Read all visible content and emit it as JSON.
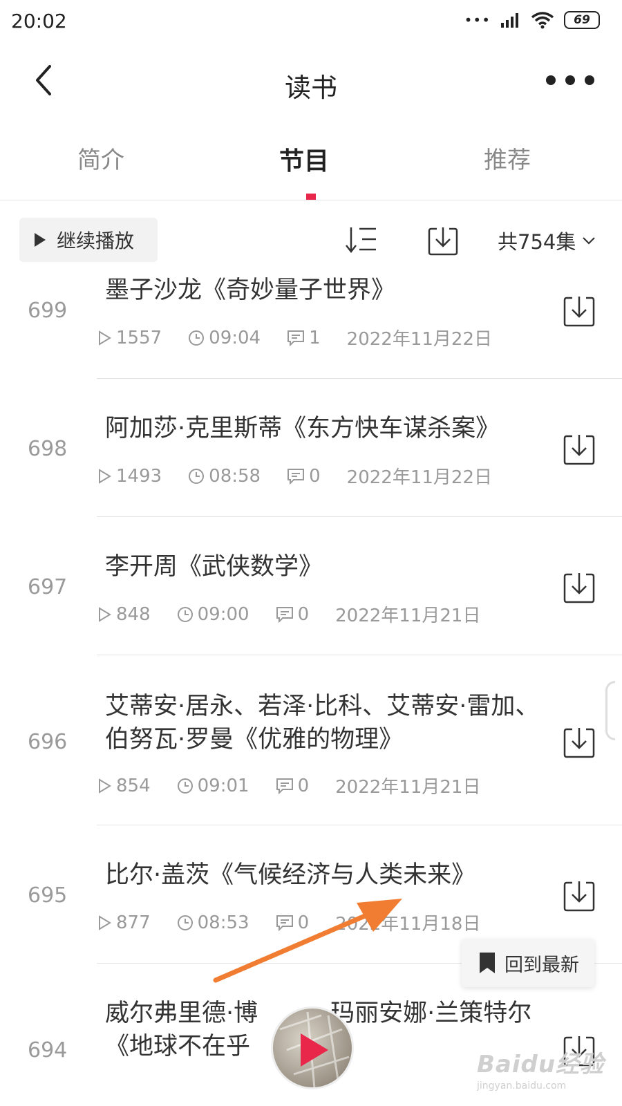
{
  "status_bar": {
    "time": "20:02",
    "signal_dots": "•••",
    "battery": "69"
  },
  "nav": {
    "title": "读书"
  },
  "tabs": [
    {
      "label": "简介",
      "active": false
    },
    {
      "label": "节目",
      "active": true
    },
    {
      "label": "推荐",
      "active": false
    }
  ],
  "toolbar": {
    "continue_label": "继续播放",
    "episode_count": "共754集"
  },
  "episodes": [
    {
      "num": "699",
      "title": "墨子沙龙《奇妙量子世界》",
      "plays": "1557",
      "duration": "09:04",
      "comments": "1",
      "date": "2022年11月22日"
    },
    {
      "num": "698",
      "title": "阿加莎·克里斯蒂《东方快车谋杀案》",
      "plays": "1493",
      "duration": "08:58",
      "comments": "0",
      "date": "2022年11月22日"
    },
    {
      "num": "697",
      "title": "李开周《武侠数学》",
      "plays": "848",
      "duration": "09:00",
      "comments": "0",
      "date": "2022年11月21日"
    },
    {
      "num": "696",
      "title": "艾蒂安·居永、若泽·比科、艾蒂安·雷加、伯努瓦·罗曼《优雅的物理》",
      "plays": "854",
      "duration": "09:01",
      "comments": "0",
      "date": "2022年11月21日"
    },
    {
      "num": "695",
      "title": "比尔·盖茨《气候经济与人类未来》",
      "plays": "877",
      "duration": "08:53",
      "comments": "0",
      "date": "2022年11月18日"
    },
    {
      "num": "694",
      "title": "威尔弗里德·博　　　玛丽安娜·兰策特尔《地球不在乎",
      "plays": "",
      "duration": "",
      "comments": "",
      "date": ""
    }
  ],
  "float_button": {
    "label": "回到最新"
  },
  "watermark": {
    "logo": "Baidu经验",
    "url": "jingyan.baidu.com"
  },
  "colors": {
    "accent": "#e8274b",
    "arrow": "#f07d32",
    "meta_gray": "#999999"
  }
}
